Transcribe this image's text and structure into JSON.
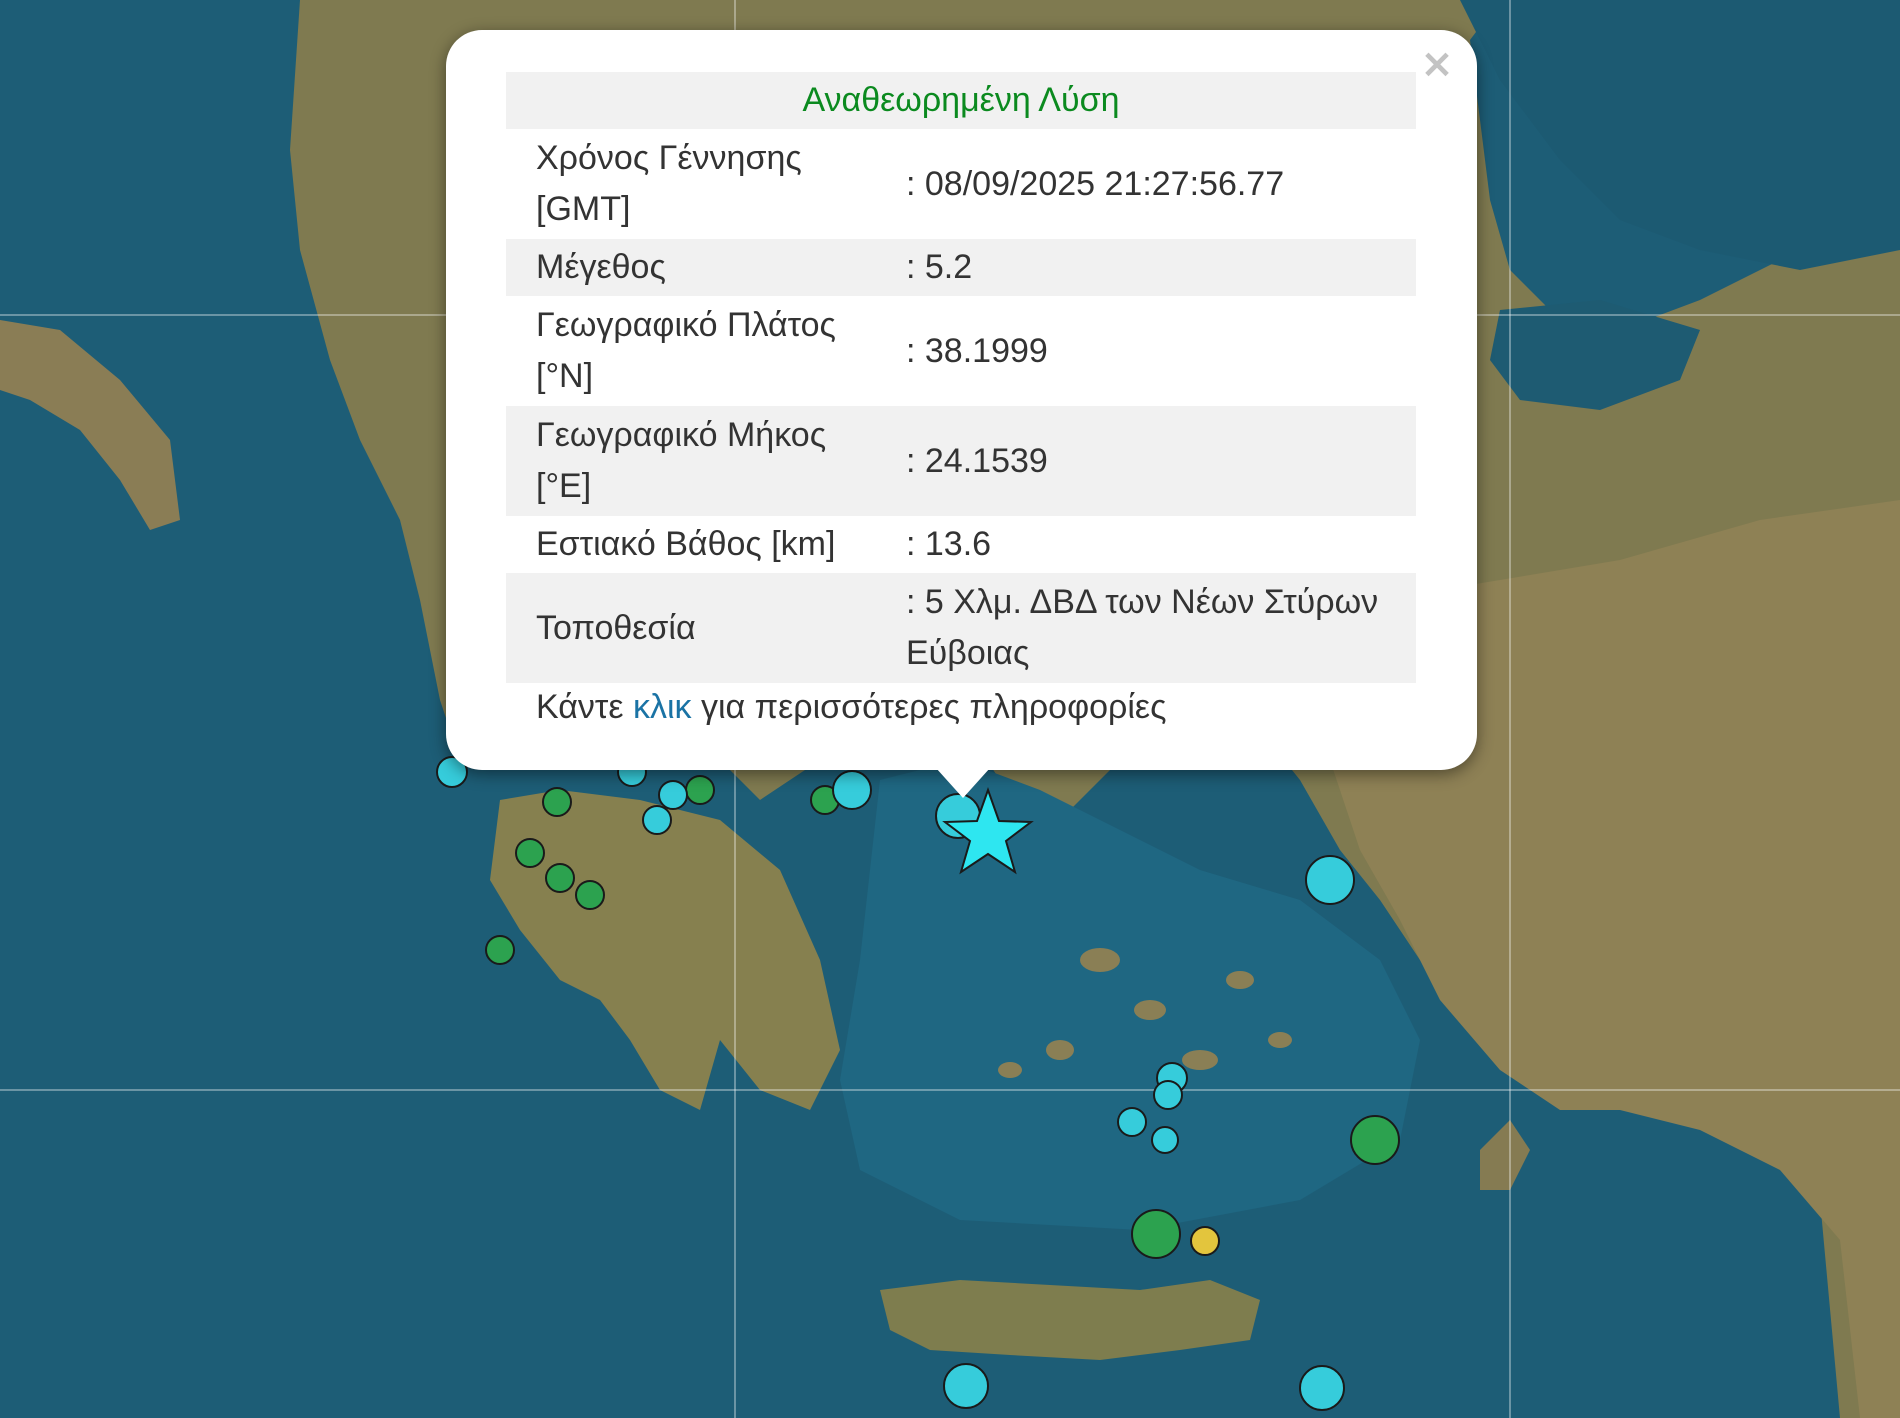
{
  "map": {
    "colors": {
      "sea": "#1d5d76",
      "land": "#8d7f55",
      "marker_cyan": "#36ccdb",
      "marker_green": "#2ca24f",
      "marker_yellow": "#e3c53d",
      "epicenter_star": "#2ee6f0"
    },
    "epicenter": {
      "lat": 38.1999,
      "lon": 24.1539
    }
  },
  "popup": {
    "title": "Αναθεωρημένη Λύση",
    "close_symbol": "×",
    "rows": [
      {
        "label": "Χρόνος Γέννησης [GMT]",
        "value": ": 08/09/2025 21:27:56.77"
      },
      {
        "label": "Μέγεθος",
        "value": ": 5.2"
      },
      {
        "label": "Γεωγραφικό Πλάτος [°N]",
        "value": ": 38.1999"
      },
      {
        "label": "Γεωγραφικό Μήκος [°E]",
        "value": ": 24.1539"
      },
      {
        "label": "Εστιακό Βάθος [km]",
        "value": ": 13.6"
      },
      {
        "label": "Τοποθεσία",
        "value": ": 5 Χλμ. ΔΒΔ των Νέων Στύρων Εύβοιας"
      }
    ],
    "more_prefix": "Κάντε",
    "more_link": "κλικ",
    "more_suffix": "για περισσότερες πληροφορίες"
  }
}
